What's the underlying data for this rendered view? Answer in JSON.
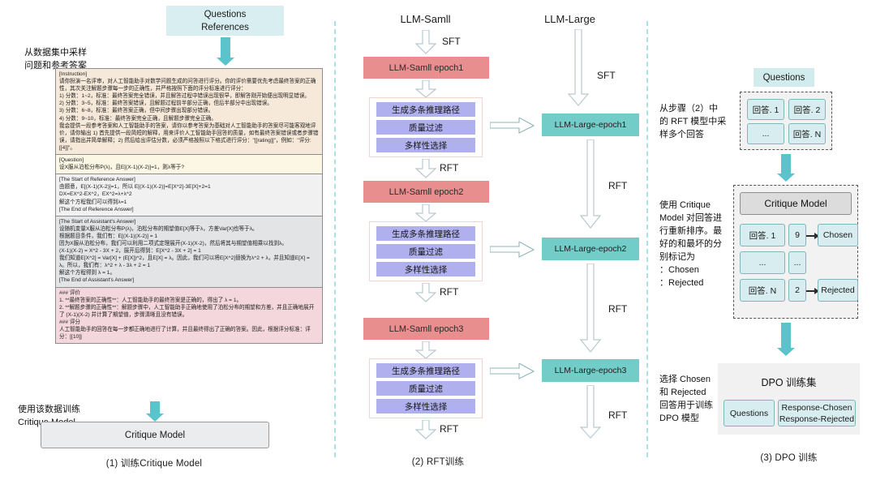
{
  "left": {
    "header_line1": "Questions",
    "header_line2": "References",
    "note_line1": "从数据集中采样",
    "note_line2": "问题和参考答案",
    "segments": {
      "instruction": "[Instruction]\n请你扮演一名评审，对人工智能助手对数学问题生成的问答进行评分。你的评价需要优先考虑最终答案的正确性，其次关注解题步骤每一步的正确性，并严格按照下面的评分标准进行评分：\n1) 分数：1~2，标准：最终答案完全错误，并且解答过程中错误出现很早，即解答刚开始便出现明显错误。\n2) 分数：3~5，标准：最终答案错误，且解题过程前半部分正确，但后半部分中出现错误。\n3) 分数：6~8，标准：最终答案正确，但中间步骤出现部分错误。\n4) 分数：9~10，标准：最终答案完全正确，且解题步骤完全正确。\n我会提供一段参考答案和人工智能助手的答案，请你以参考答案为基础对人工智能助手的答案尽可能客观地评价，请你输出 1) 首先提供一段简短的解释，用来评价人工智能助手回答的质量，如有最终答案错误或者步骤错误，请指出并简单解释；2) 然后给出评估分数，必须严格按照以下格式进行评分：\"[[rating]]\"，例如：\"评分:[[4]]\"。",
      "question": "[Question]\n设X服从泊松分布P(λ)，且E[(X-1)(X-2)]=1，则λ等于?",
      "reference": "[The Start of Reference Answer]\n由题意，E[(X-1)(X-2)]=1，所以 E[(X-1)(X-2)]=E[X^2]-3E[X]+2=1\nDX=EX^2-EX^2，EX^2=λ+λ^2\n解这个方程我们可以得到λ=1\n[The End of Reference Answer]",
      "assistant": "[The Start of Assistant's Answer]\n设随机变量X服从泊松分布P(λ)，泊松分布的期望值E[X]等于λ，方差Var[X]也等于λ。\n根据题目条件，我们有：E[(X-1)(X-2)] = 1\n因为X服从泊松分布，我们可以利用二项式定理展开(X-1)(X-2)，然后将其与期望值相乘以找到λ。\n(X-1)(X-2) = X^2 - 3X + 2，展开后得到：E[X^2 - 3X + 2] = 1\n我们知道E[X^2] = Var[X] + (E[X])^2，且E[X] = λ。因此，我们可以将E[X^2]替换为λ^2 + λ，并且知道E[X] = λ。所以，我们有：λ^2 + λ - 3λ + 2 = 1\n解这个方程得到 λ = 1。\n[The End of Assistant's Answer]",
      "evaluation": "### 评价\n1. **最终答案的正确性**：人工智能助手的最终答案是正确的，得出了 λ = 1。\n2. **解题步骤的正确性**：解题步骤中，人工智能助手正确地使用了泊松分布的期望和方差，并且正确地展开了 (X-1)(X-2) 并计算了期望值，步骤清晰且没有错误。\n### 评分\n人工智能助手的回答在每一步都正确地进行了计算，并且最终得出了正确的答案。因此，根据评分标准：评分：[[10]]"
    },
    "train_note_line1": "使用该数据训练",
    "train_note_line2": "Critique Model",
    "critique_model_box": "Critique Model",
    "caption": "(1) 训练Critique Model"
  },
  "middle": {
    "small_model_title": "LLM-Samll",
    "large_model_title": "LLM-Large",
    "sft_label": "SFT",
    "rft_label": "RFT",
    "small_epochs": [
      "LLM-Samll epoch1",
      "LLM-Samll epoch2",
      "LLM-Samll epoch3"
    ],
    "large_epochs": [
      "LLM-Large-epoch1",
      "LLM-Large-epoch2",
      "LLM-Large-epoch3"
    ],
    "pipeline_steps": [
      "生成多条推理路径",
      "质量过滤",
      "多样性选择"
    ],
    "caption": "(2) RFT训练"
  },
  "right": {
    "questions_label": "Questions",
    "sample_note": "从步骤（2）中\n的 RFT 模型中采\n样多个回答",
    "answers": [
      "回答. 1",
      "回答. 2",
      "...",
      "回答. N"
    ],
    "critique_note": "使用 Critique\nModel 对回答进\n行重新排序。最\n好的和最坏的分\n别标记为\n：Chosen\n：Rejected",
    "critique_model_title": "Critique Model",
    "rank_rows": [
      {
        "answer": "回答. 1",
        "score": "9",
        "label": "Chosen"
      },
      {
        "answer": "...",
        "score": "...",
        "label": ""
      },
      {
        "answer": "回答. N",
        "score": "2",
        "label": "Rejected"
      }
    ],
    "dpo_note": "选择 Chosen\n和 Rejected\n回答用于训练\nDPO 模型",
    "dpo_title": "DPO 训练集",
    "dpo_questions": "Questions",
    "dpo_response_line1": "Response-Chosen",
    "dpo_response_line2": "Response-Rejected",
    "caption": "(3) DPO 训练"
  },
  "colors": {
    "teal_header": "#d9eef0",
    "teal_arrow": "#5bc3cc",
    "red_box": "#e98e8e",
    "teal_box": "#72cdc9",
    "purple_row": "#b0b0ee",
    "divider": "#aee0e3"
  }
}
